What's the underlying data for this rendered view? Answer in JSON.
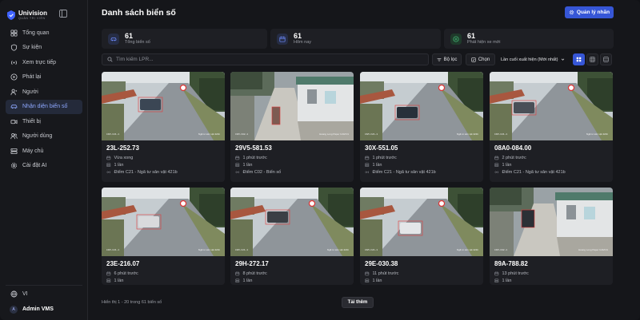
{
  "brand": {
    "name": "Univision",
    "subtitle": "QUẢN TRỊ VIÊN"
  },
  "sidebar": {
    "items": [
      {
        "label": "Tổng quan",
        "icon": "dashboard-icon",
        "active": false
      },
      {
        "label": "Sự kiện",
        "icon": "shield-icon",
        "active": false
      },
      {
        "label": "Xem trực tiếp",
        "icon": "broadcast-icon",
        "active": false
      },
      {
        "label": "Phát lại",
        "icon": "play-icon",
        "active": false
      },
      {
        "label": "Người",
        "icon": "person-icon",
        "active": false
      },
      {
        "label": "Nhận diện biển số",
        "icon": "car-icon",
        "active": true
      },
      {
        "label": "Thiết bị",
        "icon": "camera-icon",
        "active": false
      },
      {
        "label": "Người dùng",
        "icon": "users-icon",
        "active": false
      },
      {
        "label": "Máy chủ",
        "icon": "server-icon",
        "active": false
      },
      {
        "label": "Cài đặt AI",
        "icon": "gear-icon",
        "active": false
      }
    ],
    "language": "VI",
    "user": {
      "initial": "A",
      "name": "Admin VMS"
    }
  },
  "header": {
    "title": "Danh sách biển số",
    "manage_label": "Quản lý nhãn"
  },
  "stats": [
    {
      "value": "61",
      "label": "Tổng biển số",
      "color": "#6f8cff",
      "bg": "#262d45",
      "icon": "car-icon"
    },
    {
      "value": "61",
      "label": "Hôm nay",
      "color": "#6f8cff",
      "bg": "#262d45",
      "icon": "calendar-icon"
    },
    {
      "value": "61",
      "label": "Phát hiện xe mới",
      "color": "#46c27b",
      "bg": "#1f3a2b",
      "icon": "plus-icon"
    }
  ],
  "toolbar": {
    "search_placeholder": "Tìm kiếm LPR...",
    "filter_label": "Bộ lọc",
    "select_label": "Chọn",
    "sort_label": "Lần cuối xuất hiện (Mới nhất)"
  },
  "cards": [
    {
      "plate": "23L-252.73",
      "time": "Vừa xong",
      "count": "1 lần",
      "location": "Điểm C21 - Ngã tư sân vật 421b",
      "scene": "a",
      "ts": "CAM-C21-1",
      "cam": "Ngã tư sân vật 421b"
    },
    {
      "plate": "29V5-581.53",
      "time": "1 phút trước",
      "count": "1 lần",
      "location": "Điểm C02 - Biển số",
      "scene": "b",
      "ts": "CAM-C02-1",
      "cam": "Hoang Long Paper CAM 01"
    },
    {
      "plate": "30X-551.05",
      "time": "1 phút trước",
      "count": "1 lần",
      "location": "Điểm C21 - Ngã tư sân vật 421b",
      "scene": "a",
      "ts": "CAM-C21-1",
      "cam": "Ngã tư sân vật 421b"
    },
    {
      "plate": "08A0-084.00",
      "time": "2 phút trước",
      "count": "1 lần",
      "location": "Điểm C21 - Ngã tư sân vật 421b",
      "scene": "a",
      "ts": "CAM-C21-1",
      "cam": "Ngã tư sân vật 421b"
    },
    {
      "plate": "23E-216.07",
      "time": "6 phút trước",
      "count": "1 lần",
      "location": "",
      "scene": "a",
      "ts": "CAM-C21-1",
      "cam": "Ngã tư sân vật 421b"
    },
    {
      "plate": "29H-272.17",
      "time": "8 phút trước",
      "count": "1 lần",
      "location": "",
      "scene": "a",
      "ts": "CAM-C21-1",
      "cam": "Ngã tư sân vật 421b"
    },
    {
      "plate": "29E-030.38",
      "time": "11 phút trước",
      "count": "1 lần",
      "location": "",
      "scene": "a",
      "ts": "CAM-C21-1",
      "cam": "Ngã tư sân vật 421b"
    },
    {
      "plate": "89A-788.82",
      "time": "13 phút trước",
      "count": "1 lần",
      "location": "",
      "scene": "b",
      "ts": "CAM-C02-1",
      "cam": "Hoang Long Paper CAM 01"
    }
  ],
  "footer": {
    "info": "Hiển thị 1 - 20 trong 61 biển số",
    "load_more": "Tải thêm"
  }
}
